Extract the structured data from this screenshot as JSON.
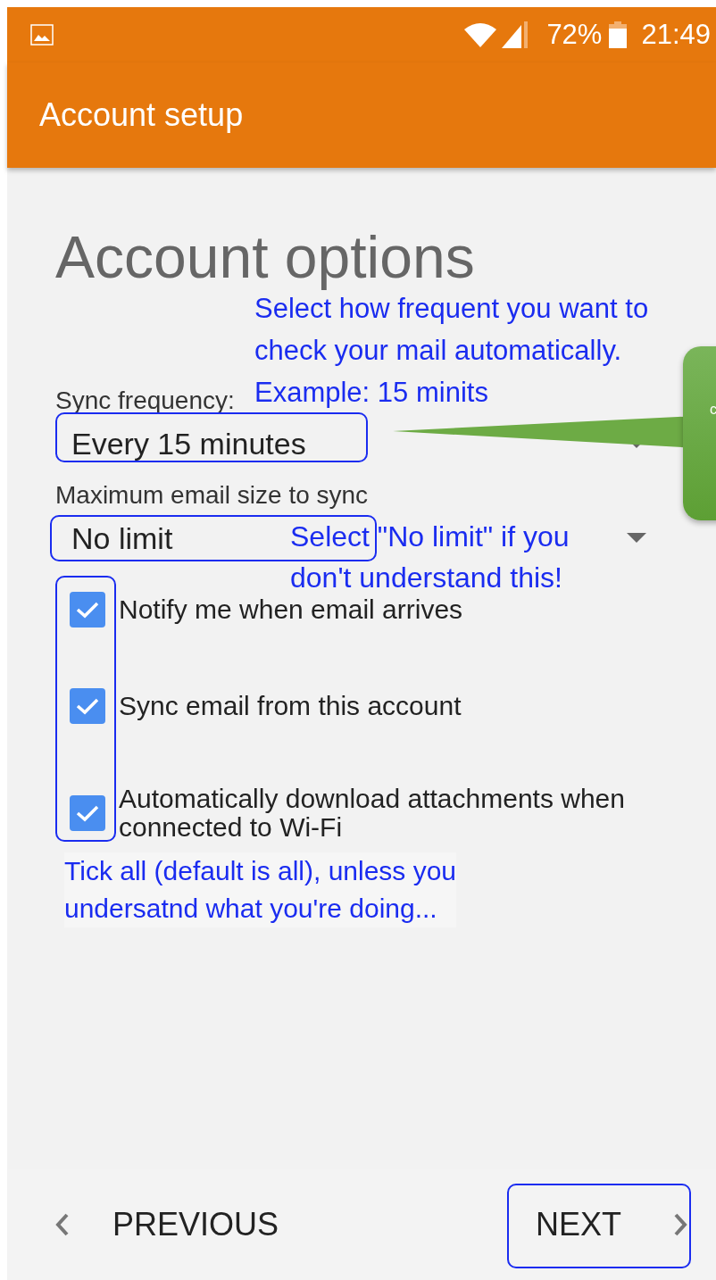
{
  "status_bar": {
    "battery": "72%",
    "time": "21:49"
  },
  "app_bar": {
    "title": "Account setup"
  },
  "heading": "Account options",
  "fields": [
    {
      "label": "Sync frequency:",
      "value": "Every 15 minutes"
    },
    {
      "label": "Maximum email size to sync",
      "value": "No limit"
    }
  ],
  "options": [
    {
      "label": "Notify me when email arrives",
      "checked": true
    },
    {
      "label": "Sync email from this account",
      "checked": true
    },
    {
      "label": "Automatically download attachments when connected to Wi-Fi",
      "checked": true
    }
  ],
  "annotations": {
    "frequency_note": [
      "Select how frequent you want to",
      "check your mail automatically.",
      "Example: 15 minits"
    ],
    "limit_note": [
      "Select \"No limit\" if you",
      "don't understand this!"
    ],
    "tick_note": [
      "Tick all (default is all), unless you",
      "undersatnd what you're doing..."
    ],
    "callout_text": "c"
  },
  "footer": {
    "previous": "PREVIOUS",
    "next": "NEXT"
  }
}
